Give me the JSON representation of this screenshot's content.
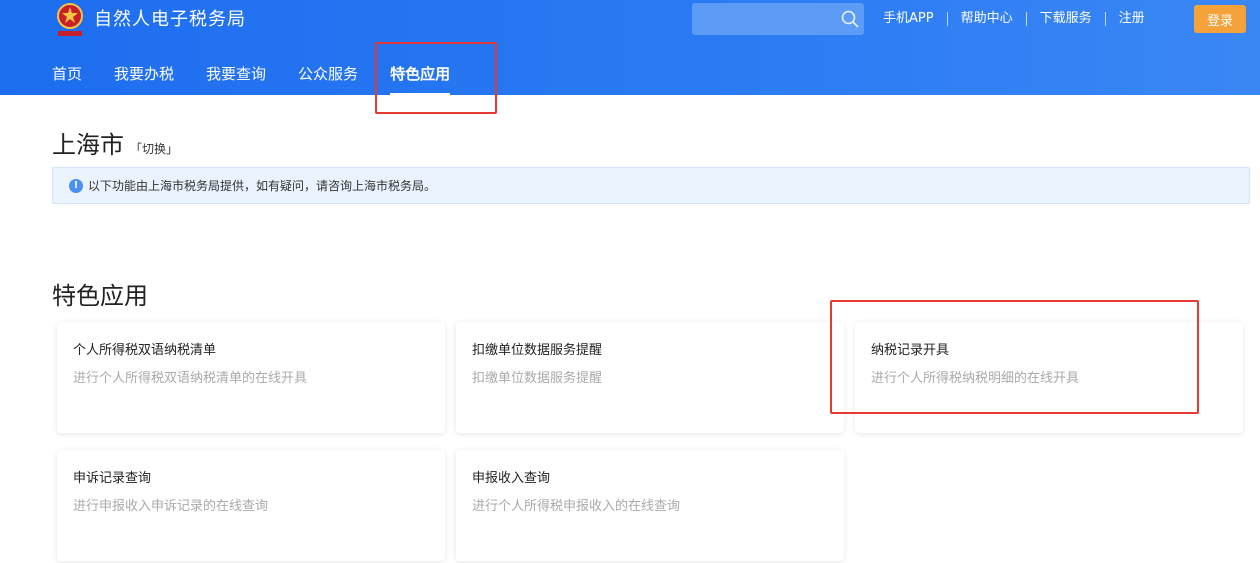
{
  "header": {
    "site_title": "自然人电子税务局",
    "search": {
      "placeholder": ""
    },
    "top_links": [
      "手机APP",
      "帮助中心",
      "下载服务",
      "注册"
    ],
    "login_label": "登录",
    "nav": [
      "首页",
      "我要办税",
      "我要查询",
      "公众服务",
      "特色应用"
    ],
    "active_nav": "特色应用"
  },
  "region": {
    "city": "上海市",
    "switch_label": "「切换」"
  },
  "notice": {
    "text": "以下功能由上海市税务局提供，如有疑问，请咨询上海市税务局。"
  },
  "section": {
    "title": "特色应用"
  },
  "cards": [
    {
      "title": "个人所得税双语纳税清单",
      "desc": "进行个人所得税双语纳税清单的在线开具"
    },
    {
      "title": "扣缴单位数据服务提醒",
      "desc": "扣缴单位数据服务提醒"
    },
    {
      "title": "纳税记录开具",
      "desc": "进行个人所得税纳税明细的在线开具"
    },
    {
      "title": "申诉记录查询",
      "desc": "进行申报收入申诉记录的在线查询"
    },
    {
      "title": "申报收入查询",
      "desc": "进行个人所得税申报收入的在线查询"
    }
  ],
  "colors": {
    "header_blue": "#1d6df0",
    "login_orange": "#f6a23b",
    "highlight_red": "#e53935",
    "notice_bg": "#eaf3fe"
  },
  "icons": {
    "logo": "tax-emblem-icon",
    "search": "search-icon",
    "info": "info-icon"
  }
}
